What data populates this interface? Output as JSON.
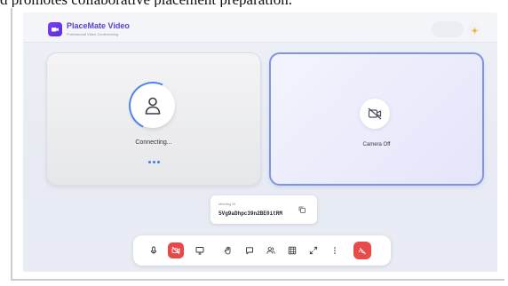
{
  "caption": "d promotes collaborative placement preparation.",
  "header": {
    "brand": "PlaceMate Video",
    "subtitle": "Professional Video Conferencing",
    "logo_icon": "video-camera-icon",
    "theme_icon": "sun-icon"
  },
  "local_tile": {
    "status": "Connecting...",
    "avatar_icon": "user-icon"
  },
  "remote_tile": {
    "status": "Camera Off",
    "icon": "camera-off-icon"
  },
  "meeting": {
    "label": "Meeting ID",
    "id": "5Vg9aDhpc39n2BE0itRM",
    "copy_icon": "copy-icon"
  },
  "controls": [
    {
      "name": "mic",
      "icon": "microphone-icon",
      "active_red": false
    },
    {
      "name": "camera",
      "icon": "camera-off-icon",
      "active_red": true
    },
    {
      "name": "screen-share",
      "icon": "monitor-icon",
      "active_red": false
    },
    {
      "name": "raise-hand",
      "icon": "hand-icon",
      "active_red": false
    },
    {
      "name": "chat",
      "icon": "chat-icon",
      "active_red": false
    },
    {
      "name": "participants",
      "icon": "users-icon",
      "active_red": false
    },
    {
      "name": "layout",
      "icon": "grid-icon",
      "active_red": false
    },
    {
      "name": "fullscreen",
      "icon": "expand-icon",
      "active_red": false
    },
    {
      "name": "more",
      "icon": "more-vertical-icon",
      "active_red": false
    },
    {
      "name": "end-call",
      "icon": "phone-end-icon",
      "active_red": true
    }
  ],
  "colors": {
    "accent": "#5b3fd1",
    "danger": "#e94848",
    "active_border": "#7e95e0"
  }
}
